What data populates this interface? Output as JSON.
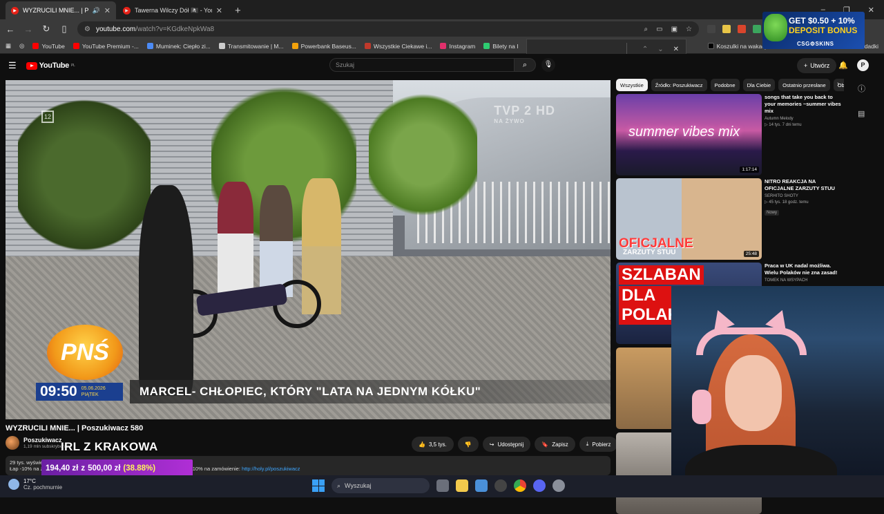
{
  "browser": {
    "tabs": [
      {
        "title": "WYZRUCILI MNIE... | Poszuki",
        "active": true,
        "audio": true
      },
      {
        "title": "Tawerna Wilczy Dół 🏴‍☠️ - YouTube",
        "active": false,
        "audio": false
      }
    ],
    "new_tab": "+",
    "window_controls": [
      "–",
      "❐",
      "✕"
    ],
    "address": {
      "host": "youtube.com",
      "path": "/watch?v=KGdkeNpkWa8"
    },
    "bookmarks": [
      {
        "label": "YouTube",
        "color": "#ff0000"
      },
      {
        "label": "YouTube Premium -...",
        "color": "#ff0000"
      },
      {
        "label": "Muminek: Ciepło zi...",
        "color": "#4c8bf5"
      },
      {
        "label": "Transmitowanie | M...",
        "color": "#cccccc"
      },
      {
        "label": "Powerbank Baseus...",
        "color": "#f2a20c"
      },
      {
        "label": "Wszystkie Ciekawe i...",
        "color": "#c0392b"
      },
      {
        "label": "Instagram",
        "color": "#e1306c"
      },
      {
        "label": "Bilety na I",
        "color": "#2ecc71"
      },
      {
        "label": "Koszulki na wakacje...",
        "color": "#000000"
      },
      {
        "label": "dadki",
        "color": "#3a3a3a"
      }
    ]
  },
  "ad": {
    "line1": "GET $0.50 + 10%",
    "line2": "DEPOSIT BONUS",
    "line3": "CSG⚙SKINS"
  },
  "youtube": {
    "logo": "YouTube",
    "logo_region": "PL",
    "search_placeholder": "Szukaj",
    "create_label": "Utwórz",
    "avatar_letter": "P"
  },
  "video": {
    "title": "WYZRUCILI MNIE... | Poszukiwacz 580",
    "channel": "Poszukiwacz",
    "subscribers": "1,19 mln subskrybentów",
    "overlay_text": "IRL Z KRAKOWA",
    "tv_logo": "TVP 2 HD",
    "tv_logo_sub": "NA ŻYWO",
    "channel_number": "12",
    "show_logo": "PNŚ",
    "time": "09:50",
    "date": "05.06.2026",
    "weekday": "PIĄTEK",
    "caption": "MARCEL- CHŁOPIEC, KTÓRY \"LATA NA JEDNYM KÓŁKU\"",
    "actions": [
      {
        "icon": "like-icon",
        "label": "3,5 tys."
      },
      {
        "icon": "dislike-icon",
        "label": ""
      },
      {
        "icon": "share-icon",
        "label": "Udostępnij"
      },
      {
        "icon": "save-icon",
        "label": "Zapisz"
      },
      {
        "icon": "download-icon",
        "label": "Pobierz"
      },
      {
        "icon": "more-icon",
        "label": "⋯"
      }
    ],
    "description_line1": "29 tys. wyświetleń  4 godziny temu",
    "description_line2_prefix": "Łap -10% na zamówienie ... kod rabatowy na zamówienie z kodem dodatkowe -10% na zamówienie: ",
    "description_link": "http://holy.pl/poszukiwacz"
  },
  "donation": {
    "current": "194,40 zł",
    "separator": "z",
    "goal": "500,00 zł",
    "percent": "(38.88%)",
    "progress_fraction": 0.3888
  },
  "chips": [
    "Wszystkie",
    "Źródło: Poszukiwacz",
    "Podobne",
    "Dla Ciebie",
    "Ostatnio przesłane",
    "Ob"
  ],
  "recommendations": [
    {
      "title": "songs that take you back to your memories ~summer vibes mix",
      "channel": "Autumn Melody",
      "views": "▷ 14 tys.  7 dni temu",
      "duration": "1:17:14",
      "thumb_text": "summer vibes mix",
      "badge": ""
    },
    {
      "title": "NITRO REAKCJA NA OFICJALNE ZARZUTY STUU",
      "channel": "SERHITO SHOTY",
      "views": "▷ 45 tys.  18 godz. temu",
      "duration": "25:48",
      "thumb_text": "OFICJALNE",
      "thumb_text2": "ZARZUTY STUU",
      "badge": "Nowy"
    },
    {
      "title": "Praca w UK nadal możliwa. Wielu Polaków nie zna zasad!",
      "channel": "TOMEK NA WSYPACH",
      "views": "",
      "duration": "",
      "thumb_text": "SZLABAN",
      "thumb_text2": "DLA POLAKÓW",
      "badge": ""
    }
  ],
  "taskbar": {
    "temperature": "17°C",
    "condition": "Cz. pochmurnie",
    "search_placeholder": "Wyszukaj"
  }
}
